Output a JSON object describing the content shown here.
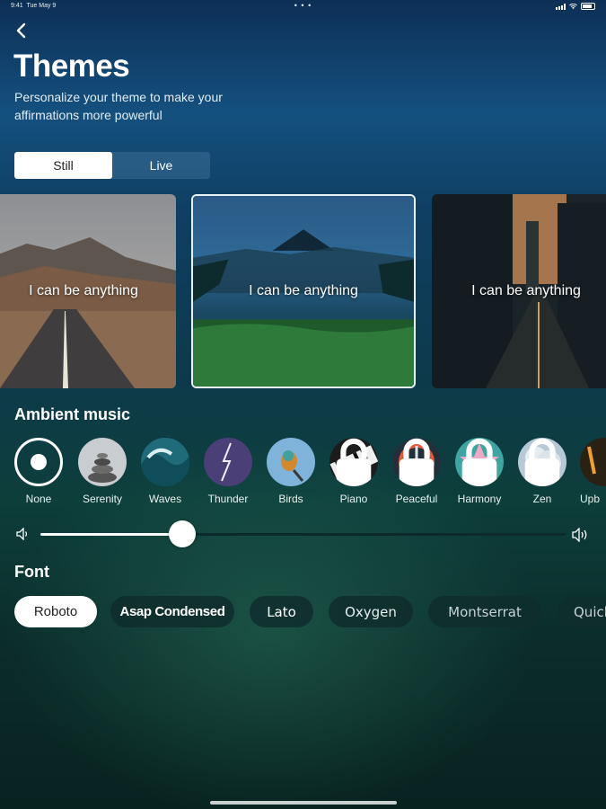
{
  "status": {
    "time": "9:41",
    "date": "Tue May 9",
    "dots": "• • •"
  },
  "header": {
    "title": "Themes",
    "subtitle": "Personalize your theme to make your affirmations more powerful",
    "back_icon": "chevron-left-icon"
  },
  "mode_tabs": [
    {
      "label": "Still",
      "selected": true
    },
    {
      "label": "Live",
      "selected": false
    }
  ],
  "themes": [
    {
      "text": "I can be anything",
      "scene": "mountain road"
    },
    {
      "text": "I can be anything",
      "scene": "misty volcano and grass",
      "selected": true
    },
    {
      "text": "I can be anything",
      "scene": "city street at sunset"
    }
  ],
  "ambient": {
    "title": "Ambient music",
    "items": [
      {
        "label": "None",
        "selected": true
      },
      {
        "label": "Serenity"
      },
      {
        "label": "Waves"
      },
      {
        "label": "Thunder"
      },
      {
        "label": "Birds"
      },
      {
        "label": "Piano",
        "locked": true
      },
      {
        "label": "Peaceful",
        "locked": true
      },
      {
        "label": "Harmony",
        "locked": true
      },
      {
        "label": "Zen",
        "locked": true
      },
      {
        "label": "Upb"
      }
    ],
    "volume": 0.27,
    "volume_low_icon": "volume-low-icon",
    "volume_high_icon": "volume-high-icon"
  },
  "font": {
    "title": "Font",
    "options": [
      {
        "label": "Roboto",
        "selected": true
      },
      {
        "label": "Asap Condensed"
      },
      {
        "label": "Lato"
      },
      {
        "label": "Oxygen"
      },
      {
        "label": "Montserrat"
      },
      {
        "label": "Quick"
      }
    ]
  },
  "colors": {
    "accent": "#ffffff",
    "chip_bg": "#0f2d2d",
    "bg_top": "#14507f",
    "bg_bottom": "#082220"
  }
}
